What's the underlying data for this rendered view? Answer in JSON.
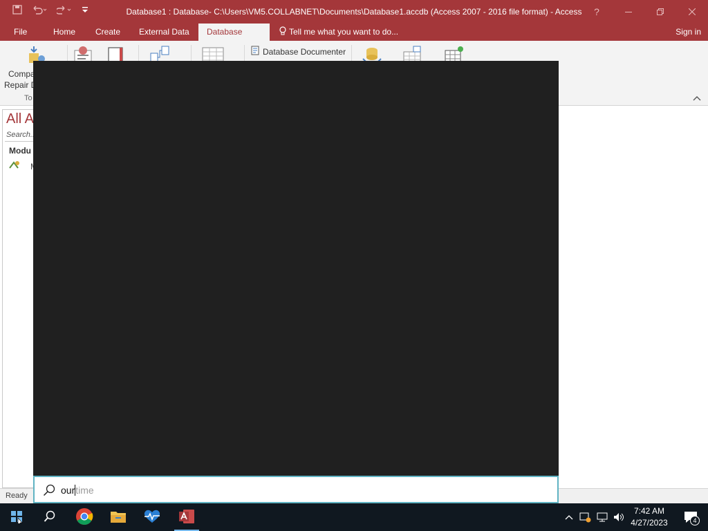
{
  "window": {
    "title": "Database1 : Database- C:\\Users\\VM5.COLLABNET\\Documents\\Database1.accdb (Access 2007 - 2016 file format) - Access",
    "help_label": "?"
  },
  "quick_access": {
    "save_icon": "save-icon",
    "undo_icon": "undo-icon",
    "redo_icon": "redo-icon",
    "customize_icon": "customize-qat-icon"
  },
  "ribbon_tabs": [
    {
      "label": "File"
    },
    {
      "label": "Home"
    },
    {
      "label": "Create"
    },
    {
      "label": "External Data"
    },
    {
      "label": "Database Tools",
      "active": true
    }
  ],
  "tell_me": "Tell me what you want to do...",
  "sign_in": "Sign in",
  "ribbon": {
    "compact_line1": "Compa",
    "compact_line2": "Repair D",
    "group_tools": "To",
    "database_documenter": "Database Documenter"
  },
  "nav_pane": {
    "heading": "All A",
    "search_placeholder": "Search...",
    "group": "Modu",
    "item": "M"
  },
  "status": {
    "text": "Ready"
  },
  "search": {
    "typed": "our",
    "suggestion": "time"
  },
  "taskbar": {
    "time": "7:42 AM",
    "date": "4/27/2023",
    "notifications": "4"
  },
  "colors": {
    "access_brand": "#a4373a",
    "flyout_bg": "#202020",
    "taskbar_bg": "#101820",
    "search_border": "#5fb3c3"
  }
}
